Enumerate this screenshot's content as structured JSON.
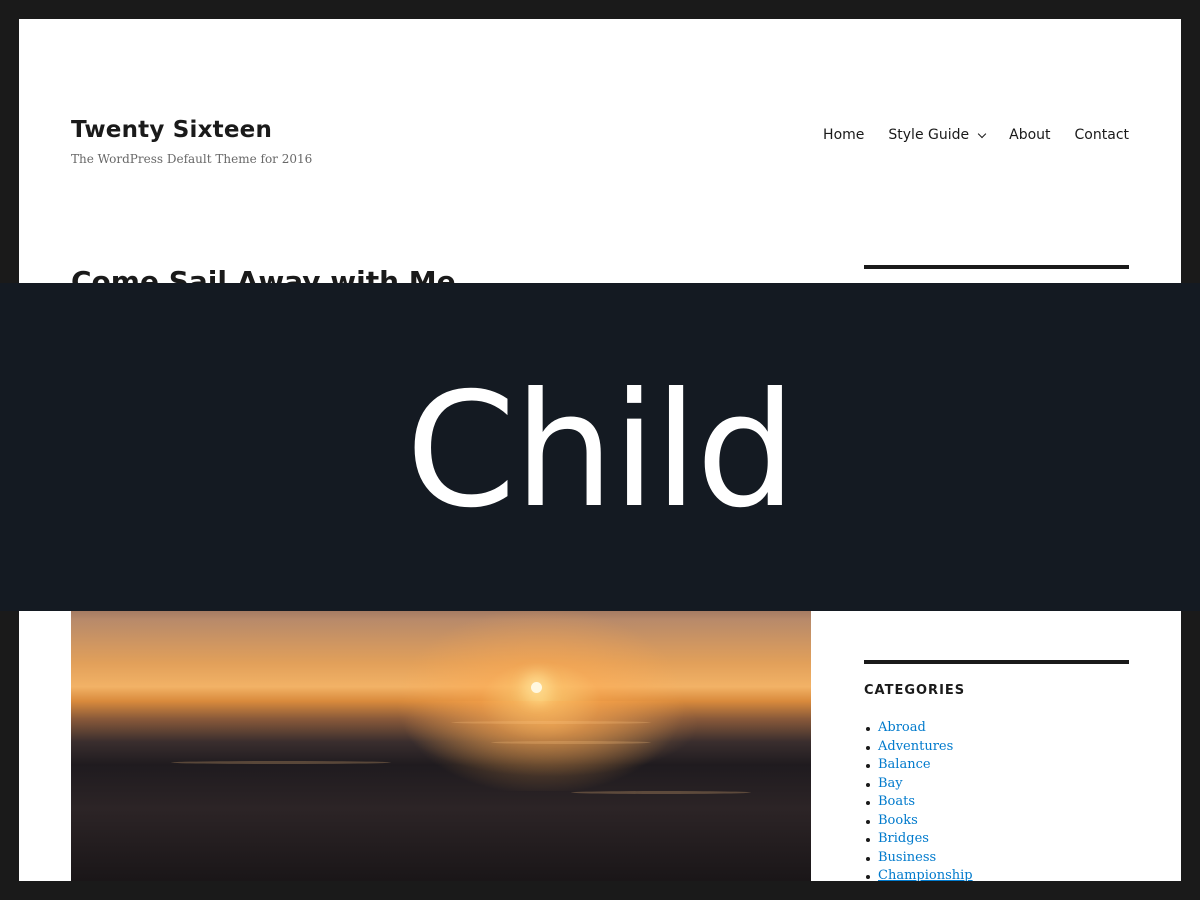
{
  "site": {
    "title": "Twenty Sixteen",
    "description": "The WordPress Default Theme for 2016"
  },
  "nav": {
    "items": [
      {
        "label": "Home"
      },
      {
        "label": "Style Guide",
        "has_submenu": true
      },
      {
        "label": "About"
      },
      {
        "label": "Contact"
      }
    ]
  },
  "post": {
    "title": "Come Sail Away with Me"
  },
  "banner": {
    "text": "Child"
  },
  "sidebar": {
    "categories_title": "CATEGORIES",
    "categories": [
      "Abroad",
      "Adventures",
      "Balance",
      "Bay",
      "Boats",
      "Books",
      "Bridges",
      "Business",
      "Championship"
    ]
  },
  "colors": {
    "link": "#007acc",
    "text": "#1a1a1a",
    "banner_bg": "#141a22",
    "frame": "#1a1a1a"
  }
}
